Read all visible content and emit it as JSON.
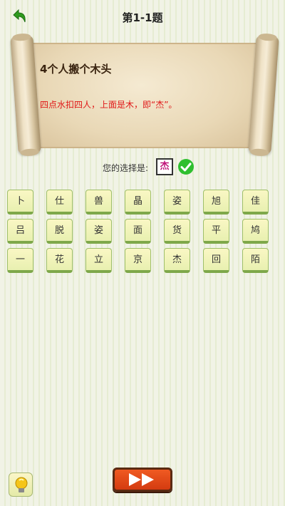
{
  "header": {
    "title": "第1-1题",
    "back_icon": "back-arrow-icon"
  },
  "puzzle": {
    "question": "4个人搬个木头",
    "hint": "四点水扣四人，上面是木，即“杰”。"
  },
  "answer": {
    "label": "您的选择是:",
    "value": "杰",
    "status_icon": "check-circle-icon",
    "status_color": "#2fbf2f"
  },
  "choices": [
    [
      "卜",
      "仕",
      "兽",
      "晶",
      "姿",
      "旭",
      "佳"
    ],
    [
      "吕",
      "脱",
      "姿",
      "面",
      "货",
      "平",
      "鸠"
    ],
    [
      "一",
      "花",
      "立",
      "京",
      "杰",
      "回",
      "陌"
    ]
  ],
  "footer": {
    "hint_icon": "lightbulb-icon",
    "next_icon": "fast-forward-icon",
    "accent": "#e24a16"
  }
}
